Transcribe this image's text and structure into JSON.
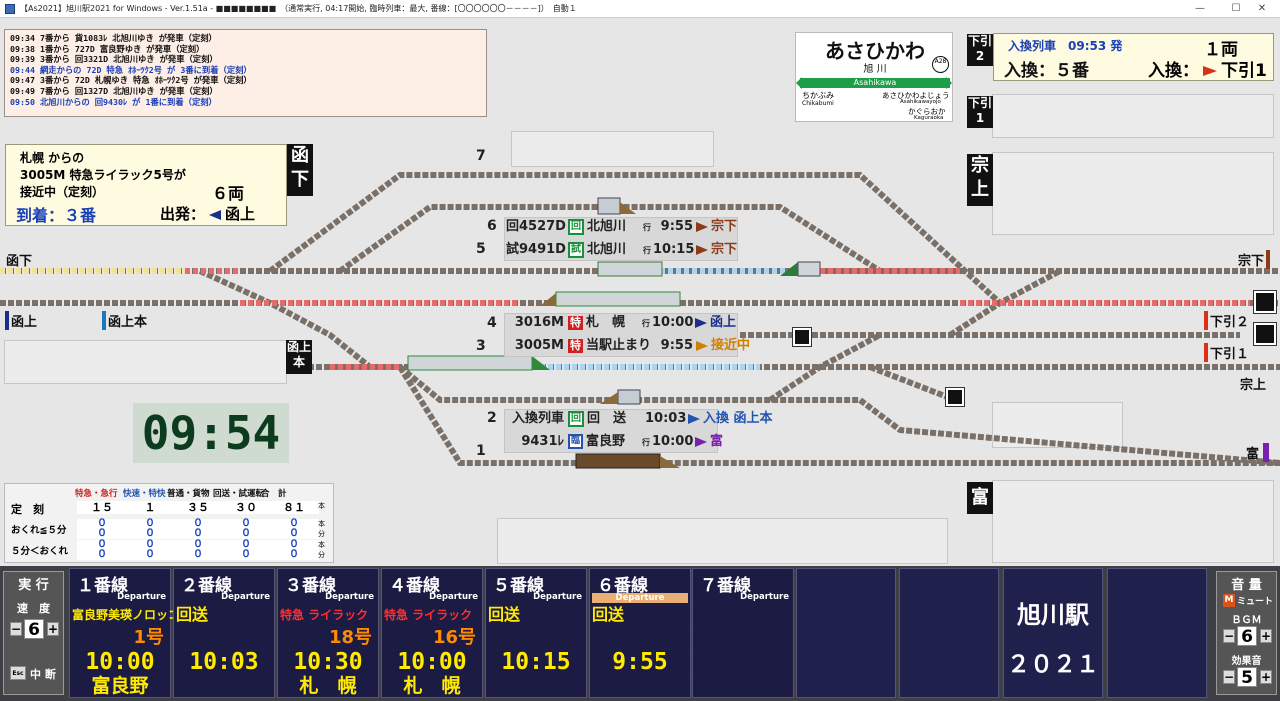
{
  "window": {
    "title": "【As2021】旭川駅2021 for Windows - Ver.1.51a - ■■■■■■■■　（通常実行, 04:17開始, 臨時列車：最大, 番線：[〇〇〇〇〇〇－－－－]）　自動１",
    "min": "—",
    "max": "☐",
    "close": "✕"
  },
  "log": [
    {
      "text": "09:34 7番から 貨1083ﾚ 北旭川ゆき が発車（定刻）",
      "color": "#111"
    },
    {
      "text": "09:38 1番から 727D 富良野ゆき が発車（定刻）",
      "color": "#111"
    },
    {
      "text": "09:39 3番から 回3321D 北旭川ゆき が発車（定刻）",
      "color": "#111"
    },
    {
      "text": "09:44 網走からの 72D 特急 ｵﾎｰﾂｸ2号 が 3番に到着（定刻）",
      "color": "#1a3fb8"
    },
    {
      "text": "09:47 3番から 72D 札幌ゆき 特急 ｵﾎｰﾂｸ2号 が発車（定刻）",
      "color": "#111"
    },
    {
      "text": "09:49 7番から 回1327D 北旭川ゆき が発車（定刻）",
      "color": "#111"
    },
    {
      "text": "09:50 北旭川からの 回9430ﾚ が 1番に到着（定刻）",
      "color": "#1a3fb8"
    }
  ],
  "sign": {
    "name": "あさひかわ",
    "kanji": "旭 川",
    "romaji": "Asahikawa",
    "code": "A28",
    "prev_kana": "ちかぶみ",
    "prev_romaji": "Chikabumi",
    "next_kana": "あさひかわよじょう",
    "next_romaji": "Asahikawayojo",
    "next2_kana": "かぐらおか",
    "next2_romaji": "Kaguraoka"
  },
  "approach": {
    "from": "札幌 からの",
    "train": "3005M 特急ライラック5号が",
    "status": "接近中（定刻）",
    "cars": "６両",
    "arrive": "到着：３番",
    "depart_label": "出発：",
    "depart_dir": "函上",
    "side": "函下"
  },
  "transfer": {
    "title": "入換列車　09:53 発",
    "cars": "１両",
    "track": "入換：５番",
    "dest_label": "入換：",
    "dest": "下引1",
    "side": "下引2"
  },
  "right_labels": {
    "shimohiki1": "下引1",
    "sou_up": "宗上",
    "tomi": "富"
  },
  "tracks": {
    "t7": "7",
    "t6": "6",
    "t5": "5",
    "t4": "4",
    "t3": "3",
    "t2": "2",
    "t1": "1"
  },
  "edge_labels": {
    "hakoshita": "函下",
    "hakoue": "函上",
    "hakouehon": "函上本",
    "hakoue_side": "函上本",
    "soushita": "宗下",
    "shimohiki2": "下引２",
    "shimohiki1b": "下引１",
    "souue": "宗上",
    "tomi": "富"
  },
  "trains": [
    {
      "id": "回4527D",
      "badge": "回",
      "dest": "北旭川",
      "yuki": "行",
      "time": "9:55",
      "dir": "宗下",
      "dircolor": "#8b3a1a"
    },
    {
      "id": "試9491D",
      "badge": "試",
      "dest": "北旭川",
      "yuki": "行",
      "time": "10:15",
      "dir": "宗下",
      "dircolor": "#8b3a1a"
    },
    {
      "id": "3016M",
      "badge": "特",
      "dest": "札　幌",
      "yuki": "行",
      "time": "10:00",
      "dir": "函上",
      "dircolor": "#1a2f8b"
    },
    {
      "id": "3005M",
      "badge": "特",
      "dest": "当駅止まり",
      "yuki": "",
      "time": "9:55",
      "dir": "接近中",
      "dircolor": "#d08000"
    },
    {
      "id": "入換列車",
      "badge": "回",
      "dest": "回　送",
      "yuki": "",
      "time": "10:03",
      "dir": "入換 函上本",
      "dircolor": "#2454b0"
    },
    {
      "id": "9431ﾚ",
      "badge": "臨",
      "dest": "富良野",
      "yuki": "行",
      "time": "10:00",
      "dir": "富",
      "dircolor": "#7a1fb0"
    }
  ],
  "clock": "09:54",
  "stats": {
    "headers": [
      "特急・急行",
      "快速・特快",
      "普通・貨物",
      "回送・試運転",
      "合　計"
    ],
    "header_colors": [
      "#d02020",
      "#2454b0",
      "#111",
      "#111",
      "#111"
    ],
    "rows": [
      {
        "label": "定　刻",
        "vals": [
          "１５",
          "１",
          "３５",
          "３０",
          "８１"
        ],
        "unit": "本"
      },
      {
        "label": "おくれ≦５分",
        "vals": [
          "０",
          "０",
          "０",
          "０",
          "０"
        ],
        "sub": [
          "０",
          "０",
          "０",
          "０",
          "０"
        ],
        "unit": "本",
        "unit2": "分"
      },
      {
        "label": "５分＜おくれ",
        "vals": [
          "０",
          "０",
          "０",
          "０",
          "０"
        ],
        "sub": [
          "０",
          "０",
          "０",
          "０",
          "０"
        ],
        "unit": "本",
        "unit2": "分"
      }
    ]
  },
  "platforms": [
    {
      "title": "１番線",
      "dep": "Departure",
      "type": "富良野美瑛ノロッコ",
      "num": "1号",
      "time": "10:00",
      "dest": "富良野",
      "red": false
    },
    {
      "title": "２番線",
      "dep": "Departure",
      "type": "回送",
      "num": "",
      "time": "10:03",
      "dest": "",
      "red": false
    },
    {
      "title": "３番線",
      "dep": "Departure",
      "type": "特急 ライラック",
      "num": "18号",
      "time": "10:30",
      "dest": "札　幌",
      "red": true
    },
    {
      "title": "４番線",
      "dep": "Departure",
      "type": "特急 ライラック",
      "num": "16号",
      "time": "10:00",
      "dest": "札　幌",
      "red": true
    },
    {
      "title": "５番線",
      "dep": "Departure",
      "type": "回送",
      "num": "",
      "time": "10:15",
      "dest": "",
      "red": false
    },
    {
      "title": "６番線",
      "dep": "Departure",
      "type": "回送",
      "num": "",
      "time": "9:55",
      "dest": "",
      "red": false
    },
    {
      "title": "７番線",
      "dep": "Departure",
      "type": "",
      "num": "",
      "time": "",
      "dest": "",
      "red": false
    }
  ],
  "brand": {
    "name": "旭川駅",
    "year": "２０２１"
  },
  "controls": {
    "exec_title": "実 行",
    "speed_label": "速　度",
    "speed": "6",
    "esc": "Esc",
    "stop": "中 断",
    "sound_title": "音 量",
    "mute_key": "M",
    "mute": "ミュート",
    "bgm": "ＢＧＭ",
    "bgm_val": "6",
    "se": "効果音",
    "se_val": "5",
    "minus": "−",
    "plus": "+"
  }
}
